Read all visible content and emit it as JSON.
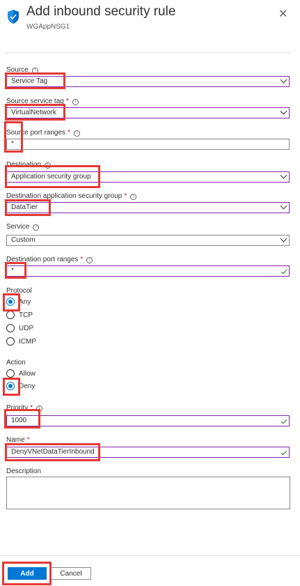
{
  "header": {
    "title": "Add inbound security rule",
    "subtitle": "WGAppNSG1",
    "icon": "shield-icon",
    "close_icon": "close-icon"
  },
  "form": {
    "source": {
      "label": "Source",
      "value": "Service Tag"
    },
    "source_service_tag": {
      "label": "Source service tag",
      "required": "*",
      "value": "VirtualNetwork"
    },
    "source_port_ranges": {
      "label": "Source port ranges",
      "required": "*",
      "value": "*"
    },
    "destination": {
      "label": "Destination",
      "value": "Application security group"
    },
    "destination_asg": {
      "label": "Destination application security group",
      "required": "*",
      "value": "DataTier"
    },
    "service": {
      "label": "Service",
      "value": "Custom"
    },
    "destination_port_ranges": {
      "label": "Destination port ranges",
      "required": "*",
      "value": "*"
    },
    "protocol": {
      "label": "Protocol",
      "options": [
        "Any",
        "TCP",
        "UDP",
        "ICMP"
      ],
      "selected": "Any"
    },
    "action": {
      "label": "Action",
      "options": [
        "Allow",
        "Deny"
      ],
      "selected": "Deny"
    },
    "priority": {
      "label": "Priority",
      "required": "*",
      "value": "1000"
    },
    "name": {
      "label": "Name",
      "required": "*",
      "value": "DenyVNetDataTierInbound"
    },
    "description": {
      "label": "Description",
      "value": ""
    }
  },
  "footer": {
    "add_label": "Add",
    "cancel_label": "Cancel"
  },
  "colors": {
    "accent": "#0078d4",
    "field_border": "#7f27a6",
    "highlight": "#e53935",
    "valid": "#107c10"
  }
}
